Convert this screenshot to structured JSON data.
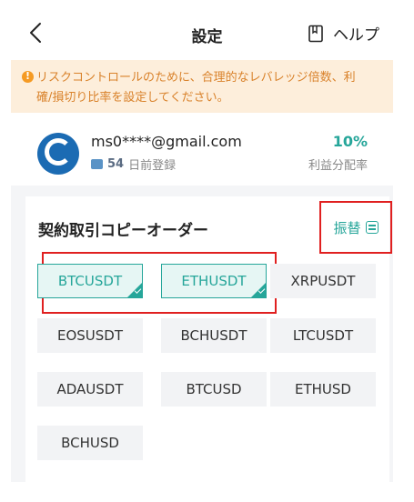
{
  "header": {
    "title": "設定",
    "help_label": "ヘルプ"
  },
  "warning": {
    "line1": "リスクコントロールのために、合理的なレバレッジ倍数、利",
    "line2": "確/損切り比率を設定してください。"
  },
  "profile": {
    "email": "ms0****@gmail.com",
    "days": "54",
    "days_label": "日前登録",
    "ratio": "10%",
    "ratio_label": "利益分配率"
  },
  "copy_orders": {
    "title": "契約取引コピーオーダー",
    "switch_label": "振替",
    "pairs": [
      {
        "label": "BTCUSDT",
        "selected": true
      },
      {
        "label": "ETHUSDT",
        "selected": true
      },
      {
        "label": "XRPUSDT",
        "selected": false
      },
      {
        "label": "EOSUSDT",
        "selected": false
      },
      {
        "label": "BCHUSDT",
        "selected": false
      },
      {
        "label": "LTCUSDT",
        "selected": false
      },
      {
        "label": "ADAUSDT",
        "selected": false
      },
      {
        "label": "BTCUSD",
        "selected": false
      },
      {
        "label": "ETHUSD",
        "selected": false
      },
      {
        "label": "BCHUSD",
        "selected": false
      }
    ]
  },
  "colors": {
    "accent": "#26a69a",
    "warning_bg": "#fdeedb",
    "warning_text": "#d9822b",
    "highlight_border": "#e02020"
  }
}
